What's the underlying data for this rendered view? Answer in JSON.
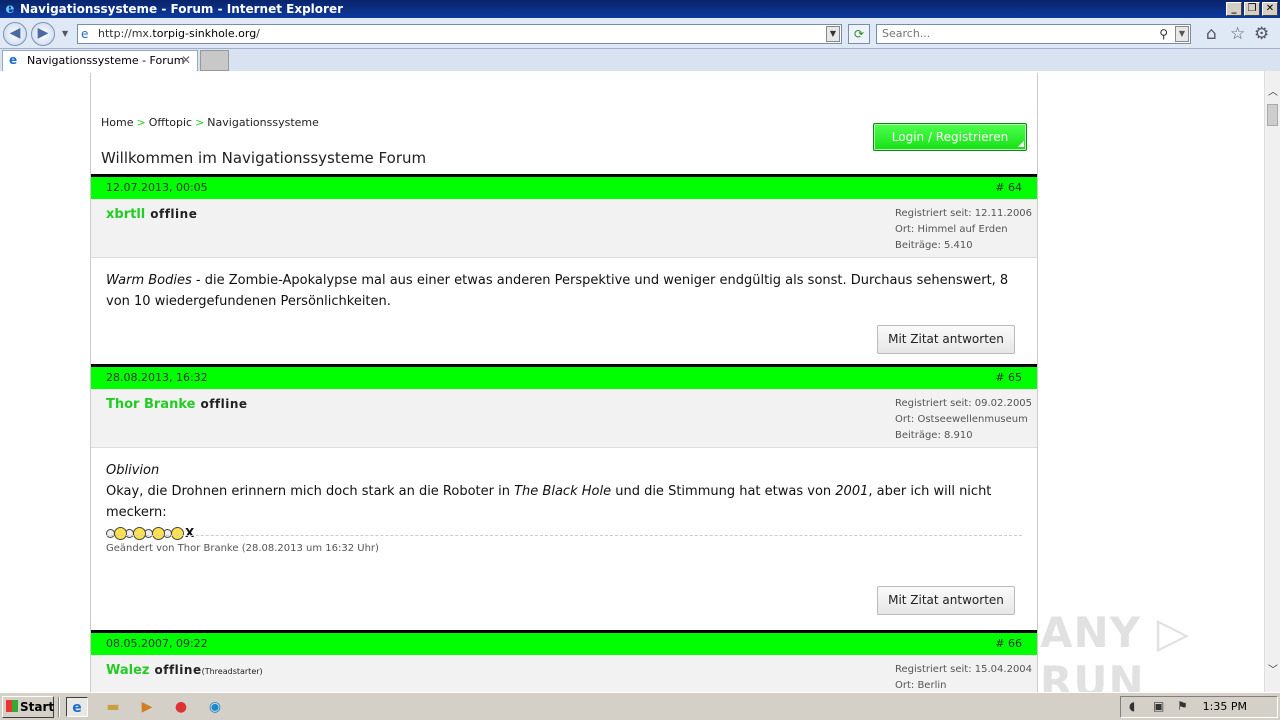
{
  "window": {
    "title": "Navigationssysteme - Forum - Internet Explorer",
    "minimize": "_",
    "maximize": "❐",
    "close": "✕"
  },
  "browser": {
    "url_prefix": "http://mx.",
    "url_host": "torpig-sinkhole.org",
    "url_suffix": "/",
    "search_placeholder": "Search...",
    "tab_title": "Navigationssysteme - Forum"
  },
  "page": {
    "breadcrumb": [
      "Home",
      "Offtopic",
      "Navigationssysteme"
    ],
    "breadcrumb_sep": ">",
    "title": "Willkommen im Navigationssysteme Forum",
    "login_label": "Login / Registrieren"
  },
  "posts": [
    {
      "date": "12.07.2013, 00:05",
      "number": "# 64",
      "author": "xbrtll",
      "status": "offline",
      "status_extra": "",
      "registered": "Registriert seit: 12.11.2006",
      "location": "Ort: Himmel auf Erden",
      "posts_count": "Beiträge: 5.410",
      "body_italic": "Warm Bodies",
      "body_rest": " - die Zombie-Apokalypse mal aus einer etwas anderen Perspektive und weniger endgültig als sonst. Durchaus sehenswert, 8 von 10 wiedergefundenen Persönlichkeiten.",
      "reply_label": "Mit Zitat antworten"
    },
    {
      "date": "28.08.2013, 16:32",
      "number": "# 65",
      "author": "Thor Branke",
      "status": "offline",
      "status_extra": "",
      "registered": "Registriert seit: 09.02.2005",
      "location": "Ort: Ostseewellenmuseum",
      "posts_count": "Beiträge: 8.910",
      "body_title": "Oblivion",
      "body_part1": "Okay, die Drohnen erinnern mich doch stark an die Roboter in ",
      "body_italic1": "The Black Hole",
      "body_part2": " und die Stimmung hat etwas von ",
      "body_italic2": "2001",
      "body_part3": ", aber ich will nicht meckern:",
      "smiley_trailer": "X",
      "edited": "Geändert von Thor Branke (28.08.2013 um 16:32 Uhr)",
      "reply_label": "Mit Zitat antworten"
    },
    {
      "date": "08.05.2007, 09:22",
      "number": "# 66",
      "author": "Walez",
      "status": "offline",
      "status_extra": "(Threadstarter)",
      "registered": "Registriert seit: 15.04.2004",
      "location": "Ort: Berlin"
    }
  ],
  "watermark": "ANY ▷ RUN",
  "taskbar": {
    "start_label": "Start",
    "clock": "1:35 PM"
  },
  "colors": {
    "accent_green": "#00ff00",
    "author_green": "#22cc22",
    "titlebar_blue": "#0a246a"
  }
}
